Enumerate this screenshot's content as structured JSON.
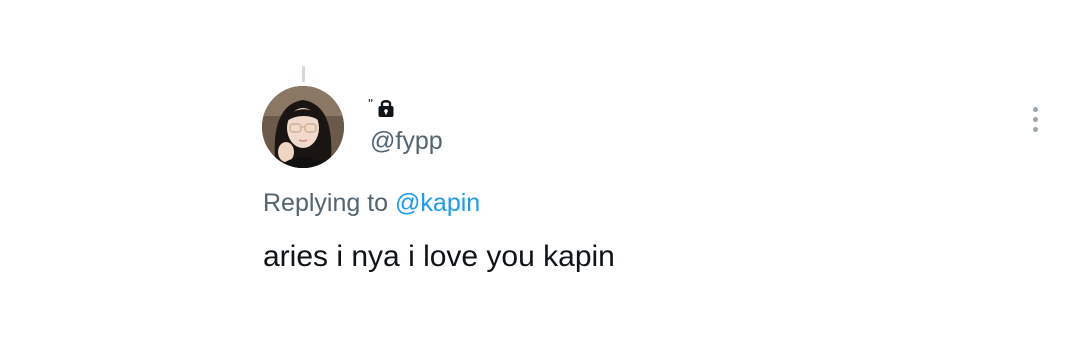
{
  "tweet": {
    "display_name": "ˮ",
    "handle": "@fypp",
    "avatar_icon": "user-avatar",
    "lock_icon": "lock-icon",
    "more_icon": "more-vertical-icon",
    "replying_prefix": "Replying to",
    "replying_to": "@kapin",
    "text": "aries i nya i love you kapin"
  },
  "colors": {
    "text_primary": "#0f1419",
    "text_secondary": "#536471",
    "mention": "#1d9bf0",
    "thread_line": "#cfd9de",
    "more_dots": "#9aa6b0"
  }
}
